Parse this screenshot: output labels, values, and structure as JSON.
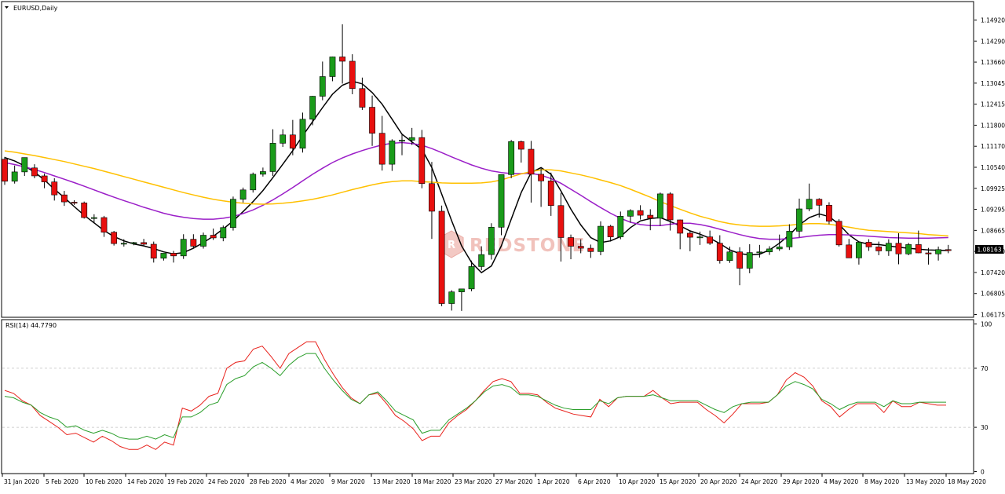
{
  "chart_data": [
    {
      "type": "candlestick",
      "title": "EURUSD,Daily",
      "price_label": "1.08163",
      "y_ticks": [
        "1.14920",
        "1.14290",
        "1.13660",
        "1.13045",
        "1.12415",
        "1.11800",
        "1.11170",
        "1.10540",
        "1.09925",
        "1.09295",
        "1.08665",
        "1.08050",
        "1.07420",
        "1.06805",
        "1.06175"
      ],
      "ylim": [
        1.0617,
        1.151
      ],
      "x_labels": [
        "31 Jan 2020",
        "5 Feb 2020",
        "10 Feb 2020",
        "14 Feb 2020",
        "19 Feb 2020",
        "24 Feb 2020",
        "28 Feb 2020",
        "4 Mar 2020",
        "9 Mar 2020",
        "13 Mar 2020",
        "18 Mar 2020",
        "23 Mar 2020",
        "27 Mar 2020",
        "1 Apr 2020",
        "6 Apr 2020",
        "10 Apr 2020",
        "15 Apr 2020",
        "20 Apr 2020",
        "24 Apr 2020",
        "29 Apr 2020",
        "4 May 2020",
        "8 May 2020",
        "13 May 2020",
        "18 May 2020"
      ],
      "candles": [
        [
          1.109,
          1.1097,
          1.1013,
          1.1024
        ],
        [
          1.1024,
          1.1071,
          1.1017,
          1.1052
        ],
        [
          1.1052,
          1.1095,
          1.104,
          1.1095
        ],
        [
          1.1064,
          1.1075,
          1.1033,
          1.104
        ],
        [
          1.104,
          1.1047,
          1.1003,
          1.1022
        ],
        [
          1.1022,
          1.1033,
          1.0966,
          1.0983
        ],
        [
          1.0983,
          1.0995,
          1.095,
          1.0962
        ],
        [
          1.0961,
          1.0967,
          1.0953,
          1.0959
        ],
        [
          1.0959,
          1.0963,
          1.0912,
          1.0915
        ],
        [
          1.0915,
          1.0925,
          1.09,
          1.0915
        ],
        [
          1.0915,
          1.092,
          1.0857,
          1.0871
        ],
        [
          1.0871,
          1.0875,
          1.0831,
          1.0837
        ],
        [
          1.0837,
          1.085,
          1.0828,
          1.0838
        ],
        [
          1.0838,
          1.0842,
          1.0832,
          1.084
        ],
        [
          1.084,
          1.0851,
          1.0829,
          1.0835
        ],
        [
          1.0835,
          1.0843,
          1.078,
          1.0793
        ],
        [
          1.0793,
          1.0805,
          1.0786,
          1.0808
        ],
        [
          1.0808,
          1.0815,
          1.078,
          1.08
        ],
        [
          1.08,
          1.0865,
          1.0791,
          1.085
        ],
        [
          1.085,
          1.0865,
          1.0822,
          1.0829
        ],
        [
          1.0829,
          1.087,
          1.0822,
          1.0862
        ],
        [
          1.0862,
          1.0882,
          1.0848,
          1.0854
        ],
        [
          1.0854,
          1.0891,
          1.0844,
          1.0885
        ],
        [
          1.0885,
          1.0978,
          1.0876,
          1.097
        ],
        [
          1.097,
          1.1005,
          1.096,
          1.0998
        ],
        [
          1.0998,
          1.105,
          1.099,
          1.1045
        ],
        [
          1.1045,
          1.1065,
          1.1038,
          1.1053
        ],
        [
          1.1053,
          1.118,
          1.104,
          1.1138
        ],
        [
          1.1138,
          1.118,
          1.1127,
          1.1163
        ],
        [
          1.1163,
          1.1208,
          1.1102,
          1.1123
        ],
        [
          1.1123,
          1.123,
          1.111,
          1.121
        ],
        [
          1.121,
          1.128,
          1.1192,
          1.1279
        ],
        [
          1.1279,
          1.1383,
          1.1267,
          1.1338
        ],
        [
          1.1338,
          1.1398,
          1.1324,
          1.1397
        ],
        [
          1.1397,
          1.1495,
          1.1317,
          1.1384
        ],
        [
          1.1384,
          1.1405,
          1.1285,
          1.1302
        ],
        [
          1.1302,
          1.1335,
          1.1238,
          1.1246
        ],
        [
          1.1246,
          1.1281,
          1.113,
          1.1168
        ],
        [
          1.1168,
          1.122,
          1.1056,
          1.1075
        ],
        [
          1.1075,
          1.115,
          1.1055,
          1.1145
        ],
        [
          1.1145,
          1.1165,
          1.1102,
          1.1147
        ],
        [
          1.1147,
          1.1184,
          1.1133,
          1.1155
        ],
        [
          1.1155,
          1.1178,
          1.1003,
          1.1017
        ],
        [
          1.1017,
          1.1082,
          1.0851,
          1.0934
        ],
        [
          1.0934,
          1.0951,
          1.0649,
          1.0657
        ],
        [
          1.0657,
          1.0697,
          1.0636,
          1.0692
        ],
        [
          1.0692,
          1.07,
          1.0635,
          1.0701
        ],
        [
          1.0701,
          1.0786,
          1.0694,
          1.0768
        ],
        [
          1.0768,
          1.0829,
          1.0757,
          1.0804
        ],
        [
          1.0804,
          1.0898,
          1.0789,
          1.0886
        ],
        [
          1.0886,
          1.1043,
          1.0862,
          1.1044
        ],
        [
          1.1044,
          1.1148,
          1.1033,
          1.1143
        ],
        [
          1.1143,
          1.1146,
          1.108,
          1.112
        ],
        [
          1.112,
          1.1145,
          1.096,
          1.1045
        ],
        [
          1.1045,
          1.1062,
          1.0947,
          1.1025
        ],
        [
          1.1025,
          1.105,
          1.092,
          1.0951
        ],
        [
          1.0951,
          1.0989,
          1.0783,
          1.0855
        ],
        [
          1.0855,
          1.0864,
          1.079,
          1.0829
        ],
        [
          1.0829,
          1.085,
          1.0808,
          1.0823
        ],
        [
          1.0823,
          1.0834,
          1.0794,
          1.0813
        ],
        [
          1.0813,
          1.0904,
          1.0802,
          1.0889
        ],
        [
          1.0889,
          1.0893,
          1.0843,
          1.0857
        ],
        [
          1.0857,
          1.0933,
          1.085,
          1.0919
        ],
        [
          1.0919,
          1.094,
          1.09,
          1.0936
        ],
        [
          1.0936,
          1.0952,
          1.0909,
          1.0922
        ],
        [
          1.0922,
          1.094,
          1.0877,
          1.0913
        ],
        [
          1.0913,
          1.099,
          1.089,
          1.0986
        ],
        [
          1.0986,
          1.0991,
          1.0876,
          1.0908
        ],
        [
          1.0908,
          1.0909,
          1.082,
          1.0868
        ],
        [
          1.0868,
          1.0875,
          1.0814,
          1.0856
        ],
        [
          1.0856,
          1.0873,
          1.0833,
          1.0857
        ],
        [
          1.0857,
          1.0876,
          1.0833,
          1.0838
        ],
        [
          1.0838,
          1.0862,
          1.0777,
          1.0786
        ],
        [
          1.0786,
          1.0828,
          1.0779,
          1.0812
        ],
        [
          1.0812,
          1.0826,
          1.0712,
          1.0763
        ],
        [
          1.0763,
          1.0835,
          1.0748,
          1.081
        ],
        [
          1.081,
          1.0833,
          1.0795,
          1.0812
        ],
        [
          1.0812,
          1.0829,
          1.0803,
          1.0821
        ],
        [
          1.0821,
          1.0864,
          1.0815,
          1.0827
        ],
        [
          1.0827,
          1.0895,
          1.0818,
          1.0874
        ],
        [
          1.0874,
          1.0972,
          1.0856,
          1.0941
        ],
        [
          1.0941,
          1.1017,
          1.0934,
          1.097
        ],
        [
          1.097,
          1.0973,
          1.0915,
          1.0952
        ],
        [
          1.0952,
          1.0961,
          1.0895,
          1.0904
        ],
        [
          1.0904,
          1.091,
          1.0828,
          1.0833
        ],
        [
          1.0833,
          1.0851,
          1.0795,
          1.0794
        ],
        [
          1.0794,
          1.0838,
          1.0774,
          1.0841
        ],
        [
          1.0841,
          1.085,
          1.0815,
          1.0827
        ],
        [
          1.0827,
          1.0843,
          1.0802,
          1.0815
        ],
        [
          1.0815,
          1.085,
          1.08,
          1.0838
        ],
        [
          1.0838,
          1.0868,
          1.0775,
          1.0806
        ],
        [
          1.0806,
          1.0839,
          1.0802,
          1.0834
        ],
        [
          1.0834,
          1.0876,
          1.0808,
          1.0809
        ],
        [
          1.0809,
          1.0824,
          1.0774,
          1.0806
        ],
        [
          1.0806,
          1.0828,
          1.0786,
          1.0819
        ],
        [
          1.0819,
          1.0833,
          1.0808,
          1.0816
        ]
      ],
      "series": [
        {
          "color": "#000000",
          "values": [
            1.1095,
            1.1085,
            1.107,
            1.1051,
            1.1028,
            1.1,
            1.0975,
            1.0948,
            1.0922,
            1.0899,
            1.0876,
            1.0858,
            1.0845,
            1.0836,
            1.083,
            1.0822,
            1.0812,
            1.0806,
            1.081,
            1.0823,
            1.084,
            1.0859,
            1.0881,
            1.0905,
            1.0933,
            1.0963,
            1.0996,
            1.1035,
            1.1075,
            1.1116,
            1.116,
            1.1203,
            1.1245,
            1.1285,
            1.1312,
            1.1324,
            1.1316,
            1.129,
            1.1255,
            1.121,
            1.1165,
            1.1142,
            1.112,
            1.1065,
            1.0985,
            1.0905,
            1.083,
            1.078,
            1.075,
            1.077,
            1.083,
            1.091,
            1.099,
            1.105,
            1.1065,
            1.1045,
            1.0995,
            1.094,
            1.0893,
            1.0855,
            1.084,
            1.0845,
            1.0858,
            1.0885,
            1.0905,
            1.0912,
            1.0915,
            1.0903,
            1.089,
            1.0875,
            1.0865,
            1.0853,
            1.0837,
            1.0818,
            1.0807,
            1.0803,
            1.0805,
            1.0818,
            1.0838,
            1.0863,
            1.0893,
            1.0915,
            1.0926,
            1.0918,
            1.0895,
            1.0863,
            1.0842,
            1.0835,
            1.0834,
            1.083,
            1.0826,
            1.0823,
            1.082,
            1.0818,
            1.0817,
            1.0816
          ]
        },
        {
          "color": "#9B1FC8",
          "values": [
            1.108,
            1.1074,
            1.1067,
            1.1059,
            1.105,
            1.104,
            1.103,
            1.102,
            1.1009,
            1.0998,
            1.0987,
            1.0976,
            1.0966,
            1.0956,
            1.0946,
            1.0937,
            1.0928,
            1.0921,
            1.0916,
            1.0912,
            1.091,
            1.091,
            1.0913,
            1.0918,
            1.0927,
            1.0938,
            1.0952,
            1.0968,
            1.0986,
            1.1005,
            1.1025,
            1.1045,
            1.1063,
            1.108,
            1.1094,
            1.1106,
            1.1116,
            1.1125,
            1.1133,
            1.1138,
            1.114,
            1.1137,
            1.1132,
            1.1122,
            1.111,
            1.1097,
            1.1085,
            1.1073,
            1.1063,
            1.1055,
            1.105,
            1.1047,
            1.1047,
            1.1048,
            1.1042,
            1.1032,
            1.1018,
            1.1,
            1.0982,
            1.0963,
            1.0945,
            1.0928,
            1.0913,
            1.0901,
            1.0894,
            1.0891,
            1.0891,
            1.0895,
            1.0898,
            1.0898,
            1.0894,
            1.0888,
            1.088,
            1.0872,
            1.0864,
            1.0857,
            1.0852,
            1.085,
            1.085,
            1.0852,
            1.0855,
            1.0859,
            1.0862,
            1.0864,
            1.0864,
            1.0863,
            1.0861,
            1.0859,
            1.0857,
            1.0855,
            1.0854,
            1.0853,
            1.0853,
            1.0853,
            1.0854,
            1.0855
          ]
        },
        {
          "color": "#FFC000",
          "values": [
            1.1115,
            1.1111,
            1.1106,
            1.1101,
            1.1095,
            1.1089,
            1.1083,
            1.1076,
            1.1069,
            1.1062,
            1.1054,
            1.1046,
            1.1038,
            1.103,
            1.1022,
            1.1014,
            1.1006,
            1.0998,
            1.099,
            1.0983,
            1.0976,
            1.097,
            1.0965,
            1.0961,
            1.0958,
            1.0956,
            1.0955,
            1.0956,
            1.0958,
            1.0961,
            1.0965,
            1.097,
            1.0976,
            1.0983,
            1.0991,
            1.0999,
            1.1006,
            1.1013,
            1.1019,
            1.1023,
            1.1025,
            1.1025,
            1.1023,
            1.1021,
            1.1019,
            1.1018,
            1.1018,
            1.1018,
            1.1019,
            1.1022,
            1.1028,
            1.1037,
            1.1046,
            1.1053,
            1.1058,
            1.1058,
            1.1055,
            1.1049,
            1.1043,
            1.1036,
            1.1028,
            1.102,
            1.1011,
            1.1,
            1.0988,
            1.0976,
            1.0963,
            1.0951,
            1.094,
            1.0929,
            1.0919,
            1.0911,
            1.0903,
            1.0897,
            1.0893,
            1.089,
            1.0889,
            1.0889,
            1.089,
            1.0892,
            1.0895,
            1.0897,
            1.0897,
            1.0895,
            1.0891,
            1.0886,
            1.0881,
            1.0877,
            1.0875,
            1.0873,
            1.0871,
            1.0869,
            1.0867,
            1.0864,
            1.0862,
            1.086
          ]
        }
      ]
    },
    {
      "type": "line",
      "title": "RSI(14) 44.7790",
      "ylim": [
        0,
        100
      ],
      "y_ticks": [
        "100",
        "70",
        "30",
        "0"
      ],
      "levels": [
        70,
        30
      ],
      "series": [
        {
          "color": "#E8211B",
          "values": [
            55,
            53,
            48,
            45,
            38,
            34,
            30,
            25,
            26,
            23,
            20,
            24,
            21,
            17,
            15,
            15,
            18,
            15,
            20,
            18,
            43,
            41,
            45,
            51,
            53,
            70,
            74,
            75,
            83,
            85,
            78,
            70,
            80,
            84,
            88,
            88,
            76,
            66,
            57,
            50,
            46,
            52,
            53,
            46,
            38,
            34,
            29,
            21,
            24,
            24,
            33,
            38,
            42,
            48,
            55,
            61,
            63,
            61,
            53,
            53,
            52,
            47,
            43,
            41,
            39,
            38,
            37,
            49,
            44,
            50,
            51,
            51,
            51,
            55,
            50,
            46,
            47,
            47,
            47,
            42,
            38,
            33,
            39,
            46,
            46,
            46,
            47,
            52,
            62,
            67,
            64,
            58,
            48,
            44,
            37,
            42,
            46,
            46,
            46,
            40,
            48,
            44,
            44,
            47,
            46,
            45,
            45
          ]
        },
        {
          "color": "#2A9E2A",
          "values": [
            51,
            50,
            47,
            45,
            40,
            37,
            35,
            30,
            31,
            28,
            26,
            28,
            26,
            23,
            22,
            22,
            24,
            22,
            25,
            23,
            37,
            37,
            40,
            45,
            47,
            59,
            63,
            65,
            71,
            74,
            70,
            65,
            72,
            77,
            80,
            80,
            70,
            62,
            55,
            49,
            46,
            52,
            54,
            48,
            41,
            38,
            35,
            26,
            28,
            28,
            35,
            39,
            43,
            48,
            54,
            58,
            59,
            57,
            52,
            52,
            51,
            48,
            45,
            43,
            42,
            42,
            42,
            48,
            46,
            50,
            51,
            51,
            51,
            52,
            50,
            48,
            48,
            48,
            48,
            45,
            42,
            40,
            44,
            46,
            47,
            47,
            47,
            52,
            58,
            61,
            59,
            56,
            49,
            46,
            42,
            45,
            47,
            47,
            47,
            44,
            48,
            46,
            46,
            47,
            47,
            47,
            47
          ]
        }
      ]
    }
  ],
  "watermark": "REDSTONE"
}
